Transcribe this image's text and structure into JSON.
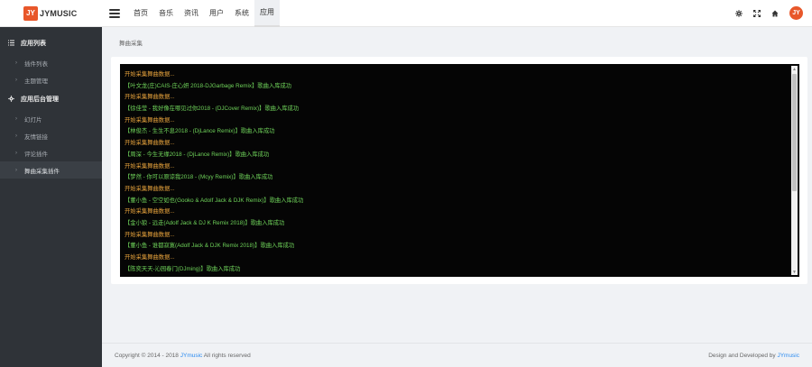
{
  "app": {
    "logo_badge": "JY",
    "logo_text": "JYMUSIC"
  },
  "nav": {
    "items": [
      {
        "label": "首页"
      },
      {
        "label": "音乐"
      },
      {
        "label": "资讯"
      },
      {
        "label": "用户"
      },
      {
        "label": "系统"
      },
      {
        "label": "应用"
      }
    ],
    "active_index": 5
  },
  "header_right": {
    "icons": [
      "gear-icon",
      "expand-icon",
      "home-icon"
    ],
    "avatar_text": "JY"
  },
  "sidebar": {
    "groups": [
      {
        "label": "应用列表",
        "icon": "list-icon",
        "items": [
          {
            "label": "插件列表"
          },
          {
            "label": "主题管理"
          }
        ]
      },
      {
        "label": "应用后台管理",
        "icon": "gear-icon",
        "items": [
          {
            "label": "幻灯片"
          },
          {
            "label": "友情链接"
          },
          {
            "label": "评论插件"
          },
          {
            "label": "舞曲采集插件",
            "active": true
          }
        ]
      }
    ]
  },
  "breadcrumb": {
    "title": "舞曲采集"
  },
  "console": {
    "lines": [
      {
        "type": "start",
        "text": "开始采集舞曲数据..."
      },
      {
        "type": "ok",
        "text": "【叶文龙(庄)CAIS-庄心妍 2018-DJGarbage Remix】歌曲入库成功"
      },
      {
        "type": "start",
        "text": "开始采集舞曲数据..."
      },
      {
        "type": "ok",
        "text": "【徐佳莹 - 我好像在哪见过你2018 - (DJCover Remix)】歌曲入库成功"
      },
      {
        "type": "start",
        "text": "开始采集舞曲数据..."
      },
      {
        "type": "ok",
        "text": "【林俊杰 - 生生不息2018 - (DjLance Remix)】歌曲入库成功"
      },
      {
        "type": "start",
        "text": "开始采集舞曲数据..."
      },
      {
        "type": "ok",
        "text": "【周深 - 今生无缘2018 - (DjLance Remix)】歌曲入库成功"
      },
      {
        "type": "start",
        "text": "开始采集舞曲数据..."
      },
      {
        "type": "ok",
        "text": "【梦然 - 你可以原谅我2018 - (Mcyy Remix)】歌曲入库成功"
      },
      {
        "type": "start",
        "text": "开始采集舞曲数据..."
      },
      {
        "type": "ok",
        "text": "【董小鱼 - 空空如也(Gooko & Adolf Jack & DJK Remix)】歌曲入库成功"
      },
      {
        "type": "start",
        "text": "开始采集舞曲数据..."
      },
      {
        "type": "ok",
        "text": "【金小狼 - 远走(Adolf Jack & DJ K Remix 2018)】歌曲入库成功"
      },
      {
        "type": "start",
        "text": "开始采集舞曲数据..."
      },
      {
        "type": "ok",
        "text": "【董小鱼 - 谁都寂寞(Adolf Jack & DJK Remix 2018)】歌曲入库成功"
      },
      {
        "type": "start",
        "text": "开始采集舞曲数据..."
      },
      {
        "type": "ok",
        "text": "【陈奕天天-沁园春门(DJming)】歌曲入库成功"
      }
    ]
  },
  "footer": {
    "copyright_prefix": "Copyright © 2014 - 2018 ",
    "copyright_link": "JYmusic",
    "copyright_suffix": " All rights reserved",
    "credit_prefix": "Design and Developed by ",
    "credit_link": "JYmusic"
  },
  "colors": {
    "brand": "#e8572a",
    "console_bg": "#050505",
    "console_start": "#e6a23c",
    "console_ok": "#6fd35a",
    "sidebar_bg": "#2f3338",
    "link": "#2d8cf0"
  }
}
